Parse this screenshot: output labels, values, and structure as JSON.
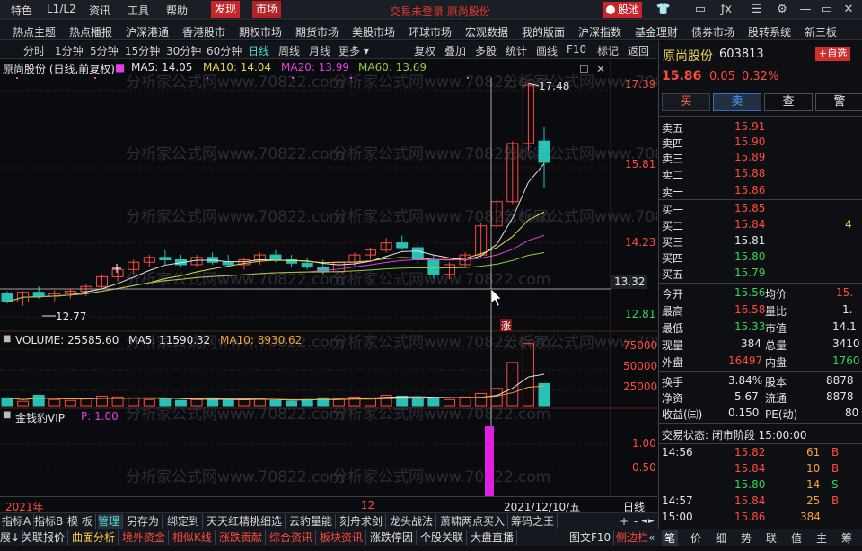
{
  "menubar": {
    "items": [
      "特色",
      "L1/L2",
      "资讯",
      "工具",
      "帮助",
      "发现",
      "市场"
    ],
    "marquee": "交易未登录  原尚股份",
    "stock_pool": "股池",
    "icons": [
      "skin-icon",
      "formula-icon",
      "menu-icon",
      "settings-icon",
      "minimize-icon",
      "maximize-icon",
      "close-icon"
    ]
  },
  "navbar": {
    "items": [
      "热点主题",
      "热点播报",
      "沪深港通",
      "香港股市",
      "期权市场",
      "期货市场",
      "美股市场",
      "环球市场",
      "宏观数据",
      "我的版面",
      "沪深指数",
      "基金理财",
      "债券市场",
      "股转系统",
      "新三板"
    ]
  },
  "periodbar": {
    "periods": [
      "分时",
      "1分钟",
      "5分钟",
      "15分钟",
      "30分钟",
      "60分钟",
      "日线",
      "周线",
      "月线",
      "更多"
    ],
    "active": "日线",
    "tools": [
      "复权",
      "叠加",
      "多股",
      "统计",
      "画线",
      "F10",
      "标记",
      "返回"
    ]
  },
  "chart": {
    "title": "原尚股份 (日线,前复权)",
    "ma_labels": [
      {
        "text": "MA5: 14.05",
        "color": "#e6e6e6"
      },
      {
        "text": "MA10: 14.04",
        "color": "#e8d34f"
      },
      {
        "text": "MA20: 13.99",
        "color": "#e33ee0"
      },
      {
        "text": "MA60: 13.69",
        "color": "#9ac83a"
      }
    ],
    "price_ticks": [
      "17.39",
      "15.81",
      "14.23",
      "13.32",
      "12.81"
    ],
    "high_label": "17.48",
    "low_label": "12.77",
    "zhang_label": "涨",
    "volume_labels": [
      {
        "text": "VOLUME: 25585.60",
        "color": "#e6e6e6"
      },
      {
        "text": "MA5: 11590.32",
        "color": "#e6e6e6"
      },
      {
        "text": "MA10: 8930.62",
        "color": "#f0a23c"
      }
    ],
    "volume_ticks": [
      "75000",
      "50000",
      "25000"
    ],
    "indicator_labels": [
      {
        "text": "金钱豹VIP",
        "color": "#e6e6e6"
      },
      {
        "text": "P: 1.00",
        "color": "#e33ee0"
      }
    ],
    "indicator_ticks": [
      "1.00",
      "0.50"
    ],
    "date_labels": [
      "2021年",
      "12",
      "2021/12/10/五"
    ],
    "period_label": "日线",
    "watermark": "分析家公式网www.70822.com",
    "colors": {
      "up": "#ff4a3d",
      "down": "#27c1b6",
      "ma5": "#e6e6e6",
      "ma10": "#e8d34f",
      "ma20": "#e33ee0",
      "ma60": "#9ac83a"
    },
    "chart_data": {
      "type": "candlestick",
      "title": "原尚股份 (日线,前复权)",
      "ohlc": [
        [
          13.15,
          13.2,
          12.95,
          12.98
        ],
        [
          12.98,
          13.2,
          12.9,
          13.18
        ],
        [
          13.18,
          13.3,
          13.05,
          13.1
        ],
        [
          13.1,
          13.22,
          13.0,
          13.15
        ],
        [
          13.15,
          13.25,
          13.05,
          13.2
        ],
        [
          13.2,
          13.35,
          13.1,
          13.3
        ],
        [
          13.3,
          13.55,
          13.25,
          13.5
        ],
        [
          13.5,
          13.7,
          13.4,
          13.65
        ],
        [
          13.65,
          13.85,
          13.55,
          13.8
        ],
        [
          13.8,
          13.95,
          13.7,
          13.9
        ],
        [
          13.9,
          14.05,
          13.75,
          13.85
        ],
        [
          13.85,
          13.95,
          13.7,
          13.75
        ],
        [
          13.75,
          13.95,
          13.7,
          13.9
        ],
        [
          13.9,
          14.0,
          13.75,
          13.8
        ],
        [
          13.8,
          13.95,
          13.7,
          13.75
        ],
        [
          13.75,
          13.9,
          13.65,
          13.85
        ],
        [
          13.85,
          14.0,
          13.75,
          13.95
        ],
        [
          13.95,
          14.05,
          13.8,
          13.85
        ],
        [
          13.85,
          13.95,
          13.7,
          13.78
        ],
        [
          13.78,
          13.9,
          13.65,
          13.7
        ],
        [
          13.7,
          13.85,
          13.55,
          13.6
        ],
        [
          13.6,
          13.85,
          13.55,
          13.8
        ],
        [
          13.8,
          14.0,
          13.7,
          13.95
        ],
        [
          13.95,
          14.1,
          13.85,
          14.05
        ],
        [
          14.05,
          14.3,
          14.0,
          14.2
        ],
        [
          14.2,
          14.35,
          14.05,
          14.1
        ],
        [
          14.1,
          14.2,
          13.75,
          13.85
        ],
        [
          13.85,
          13.95,
          13.45,
          13.55
        ],
        [
          13.55,
          13.8,
          13.45,
          13.75
        ],
        [
          13.75,
          14.0,
          13.7,
          13.95
        ],
        [
          13.95,
          14.6,
          13.9,
          14.55
        ],
        [
          14.55,
          15.1,
          14.5,
          15.05
        ],
        [
          15.05,
          16.3,
          15.0,
          16.25
        ],
        [
          16.25,
          17.48,
          16.1,
          17.45
        ],
        [
          16.3,
          16.6,
          15.33,
          15.86
        ]
      ],
      "ma5_last": 14.05,
      "ma10_last": 14.04,
      "ma20_last": 13.99,
      "ma60_last": 13.69,
      "volume": [
        9000,
        5000,
        12000,
        7000,
        6000,
        8000,
        11000,
        10000,
        9000,
        7000,
        8000,
        6000,
        7000,
        9000,
        6000,
        7000,
        8000,
        6000,
        5000,
        7000,
        9000,
        8000,
        10000,
        9000,
        12000,
        11000,
        9000,
        8000,
        7000,
        10000,
        14000,
        20000,
        50000,
        72000,
        25585.6
      ],
      "indicator_p": 1.0
    }
  },
  "quote": {
    "name": "原尚股份",
    "code": "603813",
    "add_watch": "+自选",
    "price": "15.86",
    "change": "0.05",
    "pct": "0.32%",
    "buttons": [
      "买",
      "卖",
      "查",
      "警"
    ],
    "asks": [
      {
        "label": "卖五",
        "price": "15.91",
        "cls": "red"
      },
      {
        "label": "卖四",
        "price": "15.90",
        "cls": "red"
      },
      {
        "label": "卖三",
        "price": "15.89",
        "cls": "red"
      },
      {
        "label": "卖二",
        "price": "15.88",
        "cls": "red"
      },
      {
        "label": "卖一",
        "price": "15.86",
        "cls": "red"
      }
    ],
    "bids": [
      {
        "label": "买一",
        "price": "15.85",
        "cls": "red",
        "vol": ""
      },
      {
        "label": "买二",
        "price": "15.84",
        "cls": "red",
        "vol": "4"
      },
      {
        "label": "买三",
        "price": "15.81",
        "cls": "wht",
        "vol": ""
      },
      {
        "label": "买四",
        "price": "15.80",
        "cls": "green",
        "vol": ""
      },
      {
        "label": "买五",
        "price": "15.79",
        "cls": "green",
        "vol": ""
      }
    ],
    "stats": [
      {
        "l": "今开",
        "v": "15.56",
        "vc": "green",
        "l2": "均价",
        "v2": "15.",
        "v2c": "red"
      },
      {
        "l": "最高",
        "v": "16.58",
        "vc": "red",
        "l2": "量比",
        "v2": "1.",
        "v2c": "wht"
      },
      {
        "l": "最低",
        "v": "15.33",
        "vc": "green",
        "l2": "市值",
        "v2": "14.1",
        "v2c": "wht"
      },
      {
        "l": "现量",
        "v": "384",
        "vc": "wht",
        "l2": "总量",
        "v2": "3410",
        "v2c": "wht"
      },
      {
        "l": "外盘",
        "v": "16497",
        "vc": "red",
        "l2": "内盘",
        "v2": "1760",
        "v2c": "green"
      }
    ],
    "stats2": [
      {
        "l": "换手",
        "v": "3.84%",
        "vc": "wht",
        "l2": "股本",
        "v2": "8878",
        "v2c": "wht"
      },
      {
        "l": "净资",
        "v": "5.67",
        "vc": "wht",
        "l2": "流通",
        "v2": "8878",
        "v2c": "wht"
      },
      {
        "l": "收益(㈢)",
        "v": "0.150",
        "vc": "wht",
        "l2": "PE(动)",
        "v2": "80",
        "v2c": "wht"
      }
    ],
    "trade_status": "交易状态: 闭市阶段 15:00:00",
    "ticks": [
      {
        "t": "14:56",
        "p": "15.82",
        "pc": "red",
        "v": "61",
        "vc": "org",
        "d": "B",
        "dc": "red"
      },
      {
        "t": "",
        "p": "15.84",
        "pc": "red",
        "v": "10",
        "vc": "org",
        "d": "B",
        "dc": "red"
      },
      {
        "t": "",
        "p": "15.80",
        "pc": "green",
        "v": "14",
        "vc": "org",
        "d": "S",
        "dc": "green"
      },
      {
        "t": "14:57",
        "p": "15.84",
        "pc": "red",
        "v": "25",
        "vc": "org",
        "d": "B",
        "dc": "red"
      },
      {
        "t": "15:00",
        "p": "15.86",
        "pc": "red",
        "v": "384",
        "vc": "org",
        "d": "",
        "dc": "red"
      }
    ]
  },
  "tabs1": {
    "items": [
      "指标A",
      "指标B",
      "模 板",
      "管理",
      "另存为",
      "绑定到",
      "天天红精挑细选",
      "云豹量能",
      "刻舟求剑",
      "龙头战法",
      "萧啸两点买入",
      "筹码之王"
    ],
    "controls": [
      "+",
      "-",
      "◄",
      "►"
    ]
  },
  "tabs2": {
    "items": [
      {
        "text": "展↓",
        "c": "#e0e0e0"
      },
      {
        "text": "关联报价",
        "c": "#e0e0e0"
      },
      {
        "text": "曲面分析",
        "c": "#ffcf40"
      },
      {
        "text": "境外资金",
        "c": "#ff4a3d"
      },
      {
        "text": "相似K线",
        "c": "#ff4a3d"
      },
      {
        "text": "涨跌贡献",
        "c": "#ff4a3d"
      },
      {
        "text": "综合资讯",
        "c": "#ff4a3d"
      },
      {
        "text": "板块资讯",
        "c": "#ff4a3d"
      },
      {
        "text": "涨跌停因",
        "c": "#e0e0e0"
      },
      {
        "text": "个股关联",
        "c": "#e0e0e0"
      },
      {
        "text": "大盘直播",
        "c": "#e0e0e0"
      },
      {
        "text": "图文F10",
        "c": "#e0e0e0"
      },
      {
        "text": "侧边栏",
        "c": "#ff4a3d"
      }
    ]
  },
  "rpbot": {
    "items": [
      "笔",
      "价",
      "细",
      "势",
      "联",
      "值",
      "主",
      "筹"
    ]
  }
}
